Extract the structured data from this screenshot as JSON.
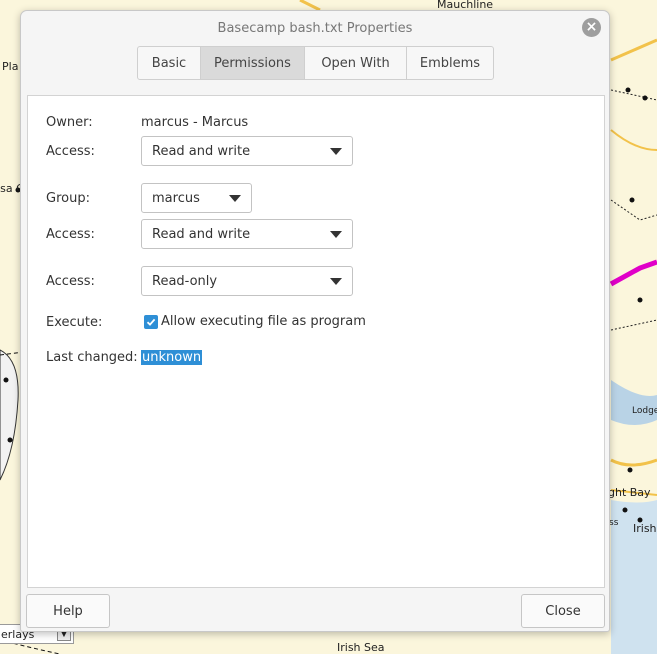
{
  "map": {
    "labels": {
      "mauchline": "Mauchline",
      "pla": "Pla",
      "ailsa": "ilsa C",
      "lodge": "Lodge",
      "bay": "ght Bay",
      "ss": "ss",
      "irish": "Irish",
      "irish_sea": "Irish Sea"
    },
    "overlays_combo": "erlays",
    "route_color": "#e000c8",
    "road_color": "#f2c24a",
    "water_color": "#b9d3e6"
  },
  "dialog": {
    "title": "Basecamp bash.txt Properties",
    "tabs": [
      {
        "label": "Basic",
        "active": false
      },
      {
        "label": "Permissions",
        "active": true
      },
      {
        "label": "Open With",
        "active": false
      },
      {
        "label": "Emblems",
        "active": false
      }
    ],
    "owner": {
      "label": "Owner:",
      "value": "marcus - Marcus"
    },
    "owner_access": {
      "label": "Access:",
      "value": "Read and write"
    },
    "group": {
      "label": "Group:",
      "value": "marcus"
    },
    "group_access": {
      "label": "Access:",
      "value": "Read and write"
    },
    "others_access": {
      "label": "Access:",
      "value": "Read-only"
    },
    "execute": {
      "label": "Execute:",
      "checkbox_label": "Allow executing file as program",
      "checked": true
    },
    "last_changed": {
      "label": "Last changed:",
      "value": "unknown"
    },
    "buttons": {
      "help": "Help",
      "close": "Close"
    },
    "accent_color": "#2e8fd6"
  }
}
